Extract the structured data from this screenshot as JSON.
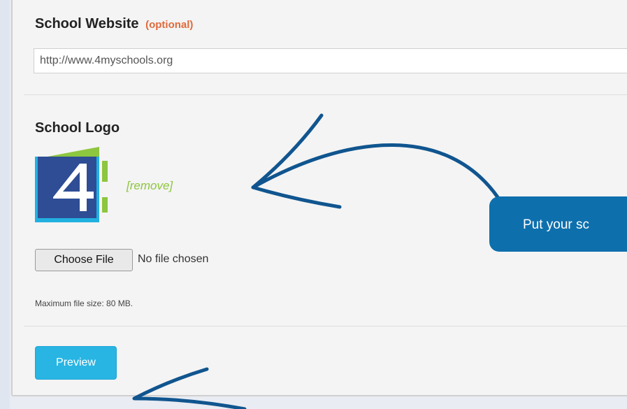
{
  "form": {
    "website": {
      "label": "School Website",
      "optional_tag": "(optional)",
      "value": "http://www.4myschools.org"
    },
    "logo": {
      "label": "School Logo",
      "remove_link": "[remove]",
      "choose_file_button": "Choose File",
      "file_status": "No file chosen",
      "max_size_note": "Maximum file size: 80 MB."
    },
    "preview_button": "Preview"
  },
  "annotation": {
    "tooltip_text": "Put your sc"
  },
  "colors": {
    "optional": "#e06a3c",
    "remove_link": "#8dc63f",
    "preview_button": "#28b5e3",
    "tooltip": "#0e6fad",
    "arrow": "#10558f"
  }
}
